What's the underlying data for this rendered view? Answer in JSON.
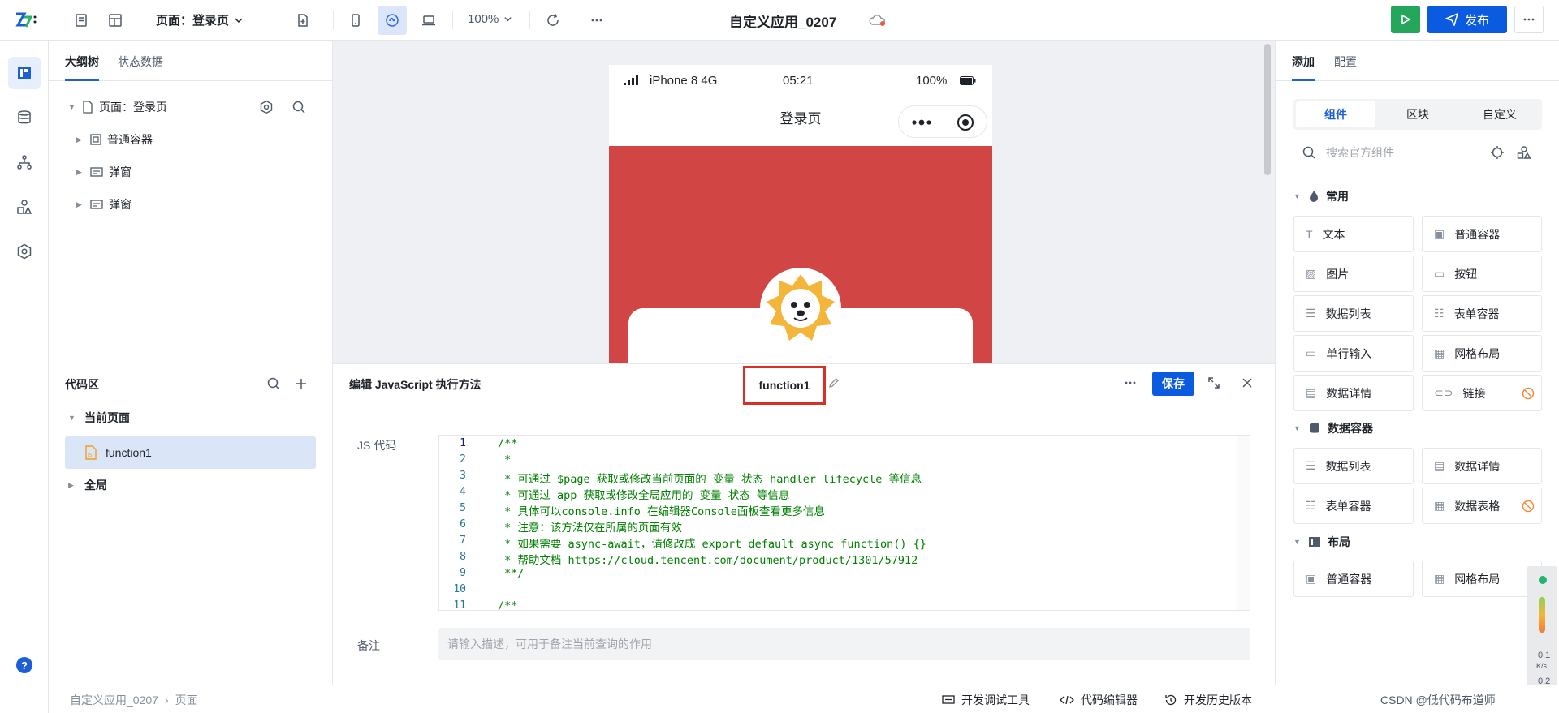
{
  "topbar": {
    "page_select": "页面：登录页",
    "zoom": "100%",
    "app_title": "自定义应用_0207",
    "publish_label": "发布"
  },
  "outline": {
    "tabs": [
      "大纲树",
      "状态数据"
    ],
    "root": "页面：登录页",
    "children": [
      "普通容器",
      "弹窗",
      "弹窗"
    ]
  },
  "code_area": {
    "title": "代码区",
    "current_page": "当前页面",
    "function_name": "function1",
    "global": "全局"
  },
  "phone": {
    "carrier": "iPhone 8  4G",
    "time": "05:21",
    "battery": "100%",
    "nav_title": "登录页"
  },
  "editor": {
    "title": "编辑 JavaScript 执行方法",
    "function_name": "function1",
    "save_label": "保存",
    "js_label": "JS 代码",
    "remark_label": "备注",
    "remark_placeholder": "请输入描述，可用于备注当前查询的作用",
    "line_numbers": [
      "1",
      "2",
      "3",
      "4",
      "5",
      "6",
      "7",
      "8",
      "9",
      "10",
      "11"
    ],
    "code_lines": [
      "/**",
      " *",
      " * 可通过 $page 获取或修改当前页面的 变量 状态 handler lifecycle 等信息",
      " * 可通过 app 获取或修改全局应用的 变量 状态 等信息",
      " * 具体可以console.info 在编辑器Console面板查看更多信息",
      " * 注意：该方法仅在所属的页面有效",
      " * 如果需要 async-await，请修改成 export default async function() {}",
      " * 帮助文档 ",
      " **/",
      "",
      "/**"
    ],
    "help_link": "https://cloud.tencent.com/document/product/1301/57912"
  },
  "right_panel": {
    "tabs": [
      "添加",
      "配置"
    ],
    "segments": [
      "组件",
      "区块",
      "自定义"
    ],
    "search_placeholder": "搜索官方组件",
    "groups": {
      "common": {
        "title": "常用",
        "items": [
          "文本",
          "普通容器",
          "图片",
          "按钮",
          "数据列表",
          "表单容器",
          "单行输入",
          "网格布局",
          "数据详情",
          "链接"
        ]
      },
      "data": {
        "title": "数据容器",
        "items": [
          "数据列表",
          "数据详情",
          "表单容器",
          "数据表格"
        ]
      },
      "layout": {
        "title": "布局",
        "items": [
          "普通容器",
          "网格布局"
        ]
      }
    }
  },
  "bottombar": {
    "crumbs": [
      "自定义应用_0207",
      "页面"
    ],
    "debug_tools": "开发调试工具",
    "code_editor": "代码编辑器",
    "history": "开发历史版本",
    "watermark": "CSDN @低代码布道师"
  },
  "net_widget": {
    "upload": "0.1",
    "upload_unit": "K/s",
    "download": "0.2"
  },
  "colors": {
    "primary": "#0b5be0",
    "run_green": "#25a75b",
    "banner_red": "#d14545",
    "highlight_red": "#d93026",
    "code_comment": "#008000"
  }
}
